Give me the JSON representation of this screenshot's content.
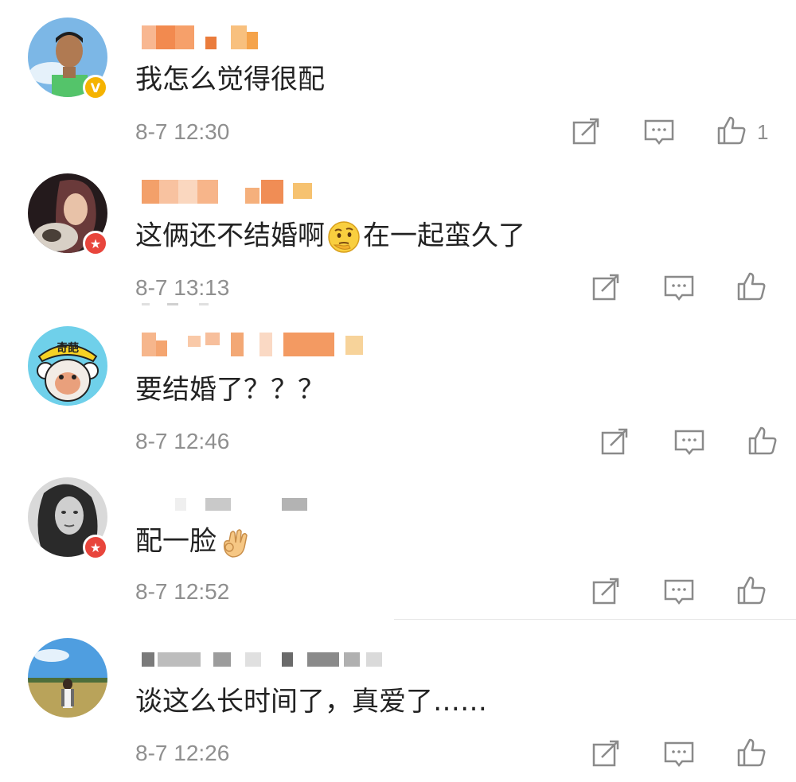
{
  "comments": [
    {
      "text": "我怎么觉得很配",
      "time": "8-7 12:30",
      "likes": "1",
      "badge": "v"
    },
    {
      "text_before": "这俩还不结婚啊",
      "text_after": "在一起蛮久了",
      "emoji": "thinking-face-emoji",
      "time": "8-7 13:13",
      "likes": "",
      "badge": "star"
    },
    {
      "text": "要结婚了？？？",
      "time": "8-7 12:46",
      "likes": "",
      "badge": "none"
    },
    {
      "text": "配一脸",
      "emoji": "ok-hand-emoji",
      "time": "8-7 12:52",
      "likes": "",
      "badge": "star"
    },
    {
      "text": "谈这么长时间了，真爱了……",
      "time": "8-7 12:26",
      "likes": "",
      "badge": "none"
    }
  ],
  "avatar3_label": "奇葩",
  "colors": {
    "badge_v": "#f5b301",
    "badge_star": "#e8453c",
    "meta_text": "#8f8f8f",
    "icon": "#8a8a8a"
  },
  "icons": [
    "share-icon",
    "comment-icon",
    "like-icon"
  ]
}
